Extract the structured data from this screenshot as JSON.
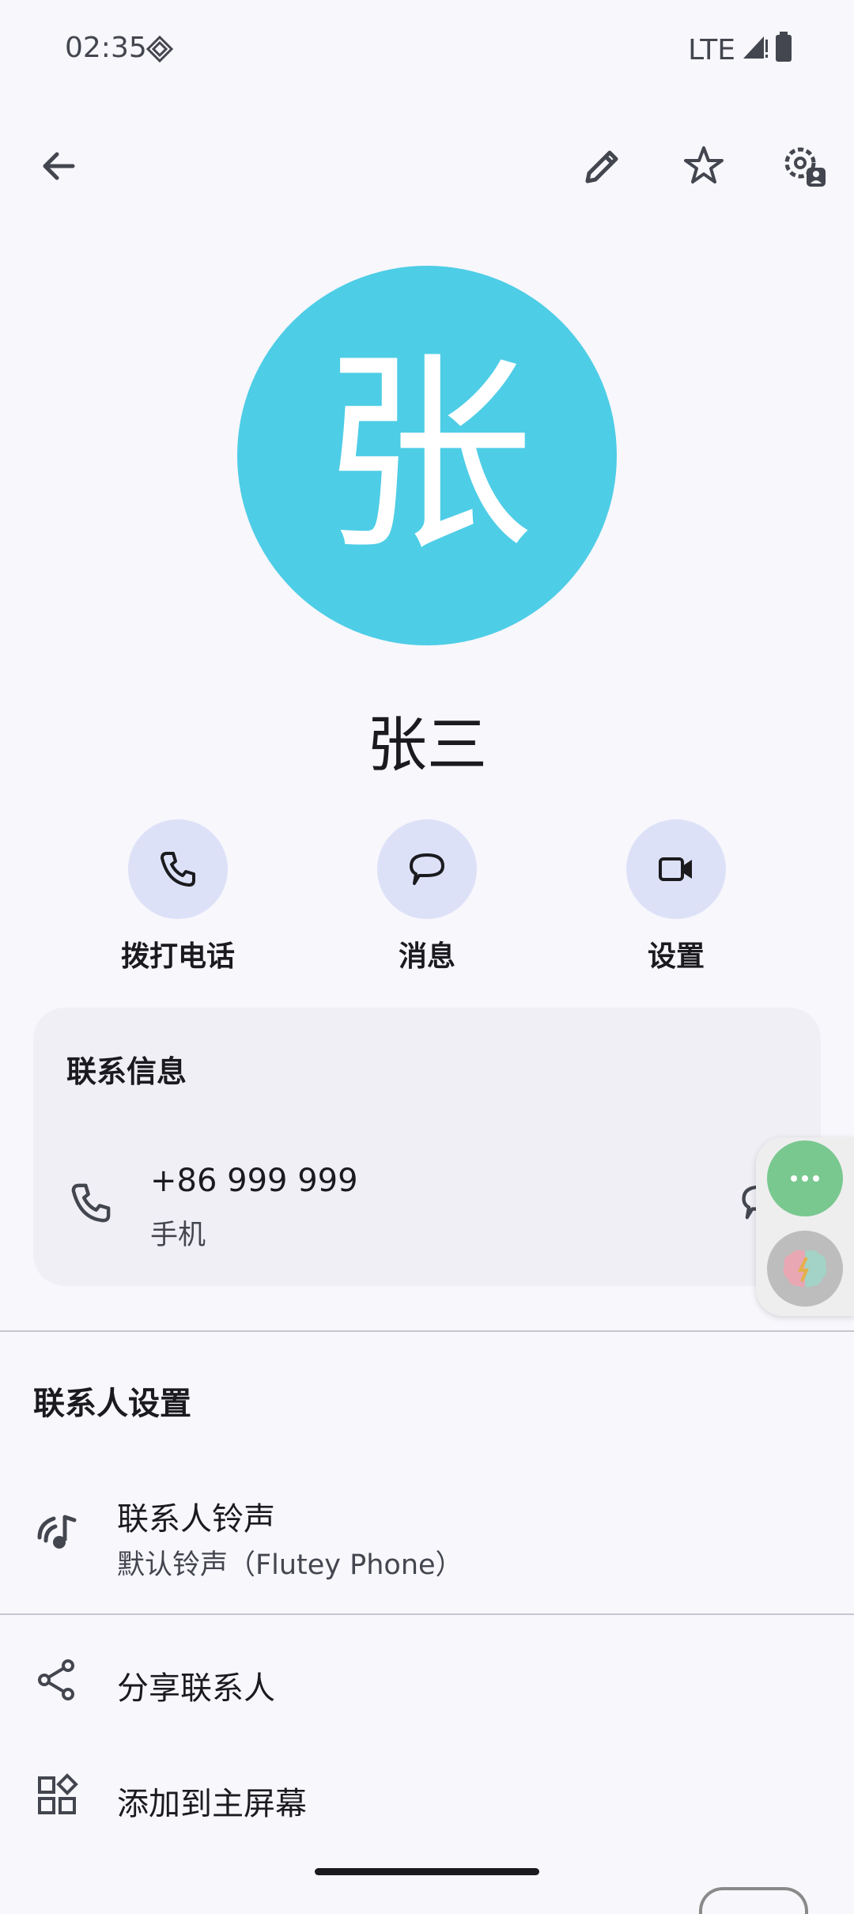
{
  "status_bar": {
    "time": "02:35",
    "network": "LTE"
  },
  "contact": {
    "avatar_letter": "张",
    "name": "张三"
  },
  "actions": [
    {
      "label": "拨打电话",
      "icon": "phone-icon"
    },
    {
      "label": "消息",
      "icon": "message-icon"
    },
    {
      "label": "设置",
      "icon": "video-icon"
    }
  ],
  "contact_info": {
    "title": "联系信息",
    "phone_number": "+86 999 999",
    "phone_type": "手机"
  },
  "contact_settings": {
    "title": "联系人设置",
    "ringtone_title": "联系人铃声",
    "ringtone_value": "默认铃声（Flutey Phone）"
  },
  "menu": {
    "share": "分享联系人",
    "add_home": "添加到主屏幕"
  },
  "colors": {
    "avatar_bg": "#4ecde6",
    "action_circle": "#dde1f8",
    "float_green": "#79c88f"
  }
}
